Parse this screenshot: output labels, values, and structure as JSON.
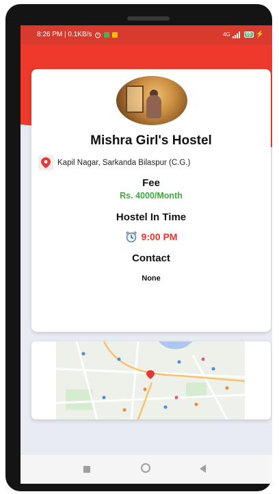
{
  "status_bar": {
    "time_speed": "8:26 PM | 0.1KB/s",
    "network_label": "4G",
    "battery": "65"
  },
  "hostel": {
    "name": "Mishra Girl's Hostel",
    "address": "Kapil Nagar, Sarkanda Bilaspur (C.G.)",
    "fee_title": "Fee",
    "fee_value": "Rs. 4000/Month",
    "in_time_title": "Hostel In Time",
    "in_time_value": "9:00 PM",
    "contact_title": "Contact",
    "contact_value": "None"
  },
  "icons": {
    "pin": "location-pin-icon",
    "clock": "alarm-clock-icon",
    "nav_recent": "square-icon",
    "nav_home": "circle-icon",
    "nav_back": "back-triangle-icon"
  },
  "colors": {
    "header_red": "#ee3a2c",
    "fee_green": "#3aaa3a",
    "time_red": "#e8362a"
  }
}
